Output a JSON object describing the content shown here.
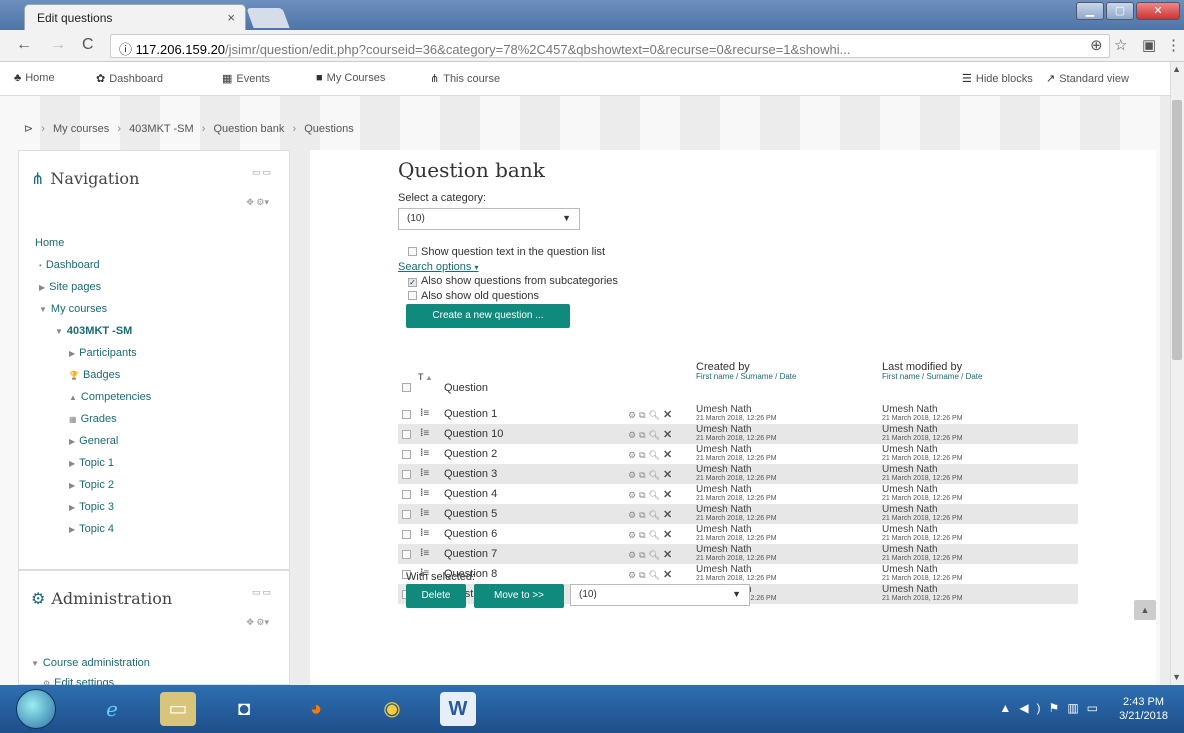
{
  "browser": {
    "tab_title": "Edit questions",
    "tab_close": "×",
    "url_domain": "117.206.159.20",
    "url_path": "/jsimr/question/edit.php?courseid=36&category=78%2C457&qbshowtext=0&recurse=0&recurse=1&showhi...",
    "info_icon": "ⓘ"
  },
  "topnav": {
    "home": "Home",
    "dashboard": "Dashboard",
    "events": "Events",
    "my_courses": "My Courses",
    "this_course": "This course",
    "hide_blocks": "Hide blocks",
    "standard_view": "Standard view"
  },
  "breadcrumb": [
    "My courses",
    "403MKT -SM",
    "Question bank",
    "Questions"
  ],
  "navigation_block": {
    "title": "Navigation",
    "items": [
      {
        "label": "Home",
        "indent": 0,
        "marker": ""
      },
      {
        "label": "Dashboard",
        "indent": 1,
        "marker": "•"
      },
      {
        "label": "Site pages",
        "indent": 1,
        "marker": "▶"
      },
      {
        "label": "My courses",
        "indent": 1,
        "marker": "▼"
      },
      {
        "label": "403MKT -SM",
        "indent": 2,
        "marker": "▼",
        "bold": true
      },
      {
        "label": "Participants",
        "indent": 3,
        "marker": "▶"
      },
      {
        "label": "Badges",
        "indent": 3,
        "marker": "🏆"
      },
      {
        "label": "Competencies",
        "indent": 3,
        "marker": "▲"
      },
      {
        "label": "Grades",
        "indent": 3,
        "marker": "▦"
      },
      {
        "label": "General",
        "indent": 3,
        "marker": "▶"
      },
      {
        "label": "Topic 1",
        "indent": 3,
        "marker": "▶"
      },
      {
        "label": "Topic 2",
        "indent": 3,
        "marker": "▶"
      },
      {
        "label": "Topic 3",
        "indent": 3,
        "marker": "▶"
      },
      {
        "label": "Topic 4",
        "indent": 3,
        "marker": "▶"
      }
    ]
  },
  "admin_block": {
    "title": "Administration",
    "items": [
      "Course administration",
      "Edit settings"
    ]
  },
  "main": {
    "title": "Question bank",
    "select_category_label": "Select a category:",
    "category_value": "(10)",
    "show_text_label": "Show question text in the question list",
    "search_options": "Search options",
    "subcat_label": "Also show questions from subcategories",
    "old_label": "Also show old questions",
    "create_button": "Create a new question ...",
    "col_question": "Question",
    "col_type": "T",
    "col_created": "Created by",
    "col_created_sub": "First name / Surname / Date",
    "col_modified": "Last modified by",
    "col_modified_sub": "First name / Surname / Date",
    "rows": [
      {
        "name": "Question 1",
        "created": "Umesh Nath",
        "created_date": "21 March 2018, 12:26 PM",
        "modified": "Umesh Nath",
        "modified_date": "21 March 2018, 12:26 PM"
      },
      {
        "name": "Question 10",
        "created": "Umesh Nath",
        "created_date": "21 March 2018, 12:26 PM",
        "modified": "Umesh Nath",
        "modified_date": "21 March 2018, 12:26 PM"
      },
      {
        "name": "Question 2",
        "created": "Umesh Nath",
        "created_date": "21 March 2018, 12:26 PM",
        "modified": "Umesh Nath",
        "modified_date": "21 March 2018, 12:26 PM"
      },
      {
        "name": "Question 3",
        "created": "Umesh Nath",
        "created_date": "21 March 2018, 12:26 PM",
        "modified": "Umesh Nath",
        "modified_date": "21 March 2018, 12:26 PM"
      },
      {
        "name": "Question 4",
        "created": "Umesh Nath",
        "created_date": "21 March 2018, 12:26 PM",
        "modified": "Umesh Nath",
        "modified_date": "21 March 2018, 12:26 PM"
      },
      {
        "name": "Question 5",
        "created": "Umesh Nath",
        "created_date": "21 March 2018, 12:26 PM",
        "modified": "Umesh Nath",
        "modified_date": "21 March 2018, 12:26 PM"
      },
      {
        "name": "Question 6",
        "created": "Umesh Nath",
        "created_date": "21 March 2018, 12:26 PM",
        "modified": "Umesh Nath",
        "modified_date": "21 March 2018, 12:26 PM"
      },
      {
        "name": "Question 7",
        "created": "Umesh Nath",
        "created_date": "21 March 2018, 12:26 PM",
        "modified": "Umesh Nath",
        "modified_date": "21 March 2018, 12:26 PM"
      },
      {
        "name": "Question 8",
        "created": "Umesh Nath",
        "created_date": "21 March 2018, 12:26 PM",
        "modified": "Umesh Nath",
        "modified_date": "21 March 2018, 12:26 PM"
      },
      {
        "name": "Question 9",
        "created": "Umesh Nath",
        "created_date": "21 March 2018, 12:26 PM",
        "modified": "Umesh Nath",
        "modified_date": "21 March 2018, 12:26 PM"
      }
    ],
    "with_selected": "With selected:",
    "delete_button": "Delete",
    "move_button": "Move to >>",
    "move_target": "(10)"
  },
  "taskbar": {
    "time": "2:43 PM",
    "date": "3/21/2018"
  },
  "colors": {
    "accent": "#0f8a7c",
    "link": "#1a6b73",
    "taskbar": "#1d4f8a"
  }
}
